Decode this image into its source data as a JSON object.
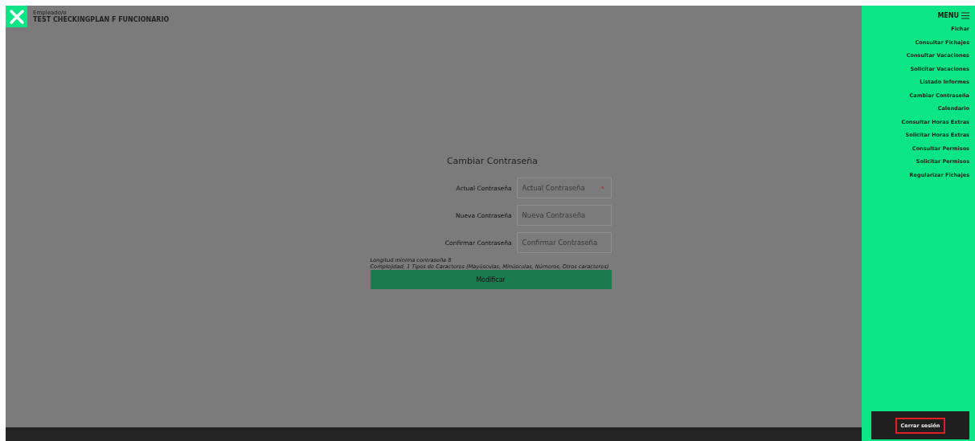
{
  "header": {
    "role": "Empleado/o",
    "name": "TEST CHECKINGPLAN F FUNCIONARIO"
  },
  "form": {
    "title": "Cambiar Contraseña",
    "fields": [
      {
        "label": "Actual Contraseña",
        "placeholder": "Actual Contraseña",
        "kind": "key"
      },
      {
        "label": "Nueva Contraseña",
        "placeholder": "Nueva Contraseña",
        "kind": "plain"
      },
      {
        "label": "Confirmar Contraseña",
        "placeholder": "Confirmar Contraseña",
        "kind": "plain"
      }
    ],
    "notes": [
      "Longitud mínima contraseña 8",
      "Complejidad, 1 Tipos de Caracteres (Mayúsculas, Minúsculas, Números, Otros caracteres)"
    ],
    "submit": "Modificar"
  },
  "menu": {
    "title": "MENU",
    "items": [
      "Fichar",
      "Consultar Fichajes",
      "Consultar Vacaciones",
      "Solicitar Vacaciones",
      "Listado Informes",
      "Cambiar Contraseña",
      "Calendario",
      "Consultar Horas Extras",
      "Solicitar Horas Extras",
      "Consultar Permisos",
      "Solicitar Permisos",
      "Regularizar Fichajes"
    ],
    "logout": {
      "label": "Cerrar sesión",
      "highlighted": true
    }
  }
}
